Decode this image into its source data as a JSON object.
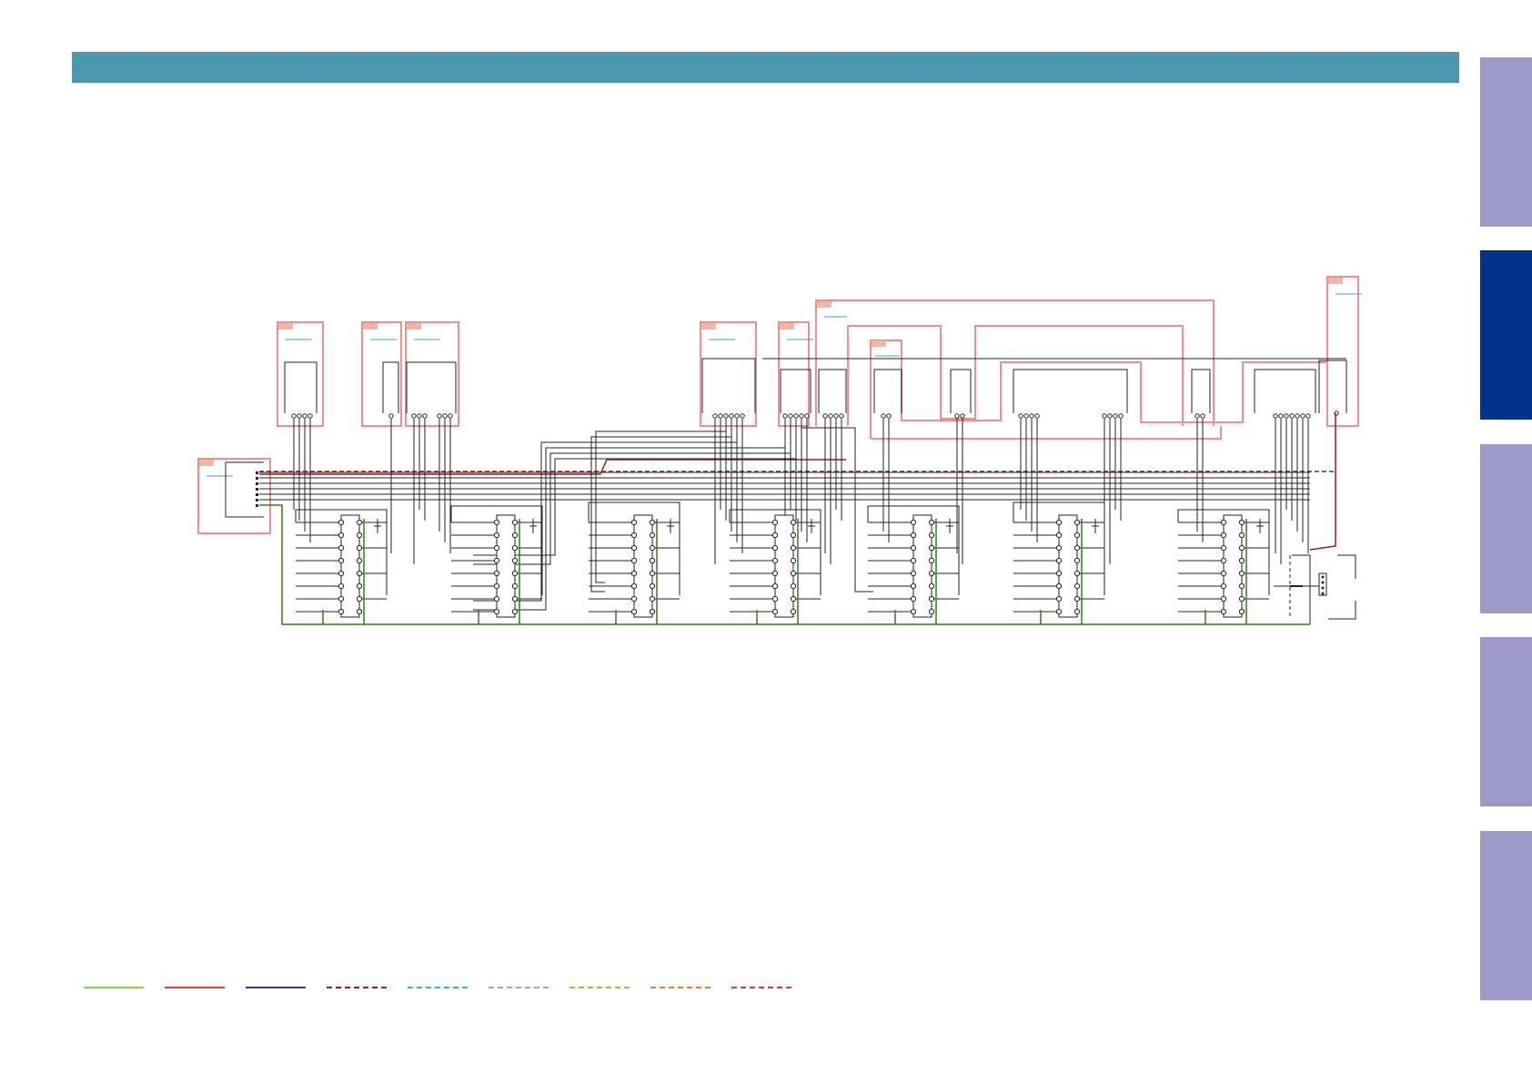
{
  "colors": {
    "header": "#4a98ae",
    "tab_inactive": "#9c99c7",
    "tab_active": "#00348a",
    "board_outline": "#ee8f8f",
    "board_tag": "#f3b4a4",
    "board_link": "#3aa6cf",
    "wire": "#222222",
    "ground_wire": "#2f7d18",
    "supply_dashed": "#9c1b1b"
  },
  "side_tabs": [
    {
      "name": "tab-1",
      "active": false
    },
    {
      "name": "tab-2",
      "active": true
    },
    {
      "name": "tab-3",
      "active": false
    },
    {
      "name": "tab-4",
      "active": false
    },
    {
      "name": "tab-5",
      "active": false
    }
  ],
  "legend": [
    {
      "style": "solid",
      "color": "#7ed93a"
    },
    {
      "style": "solid",
      "color": "#d9452c"
    },
    {
      "style": "solid",
      "color": "#2a3fa8"
    },
    {
      "style": "dashed",
      "color": "#9c1b1b"
    },
    {
      "style": "dashed",
      "color": "#2cb8cf"
    },
    {
      "style": "dashed",
      "color": "#a69cd6"
    },
    {
      "style": "dashed",
      "color": "#e0a030"
    },
    {
      "style": "dashed",
      "color": "#ef7c2a"
    },
    {
      "style": "dashed",
      "color": "#d9352a"
    }
  ]
}
